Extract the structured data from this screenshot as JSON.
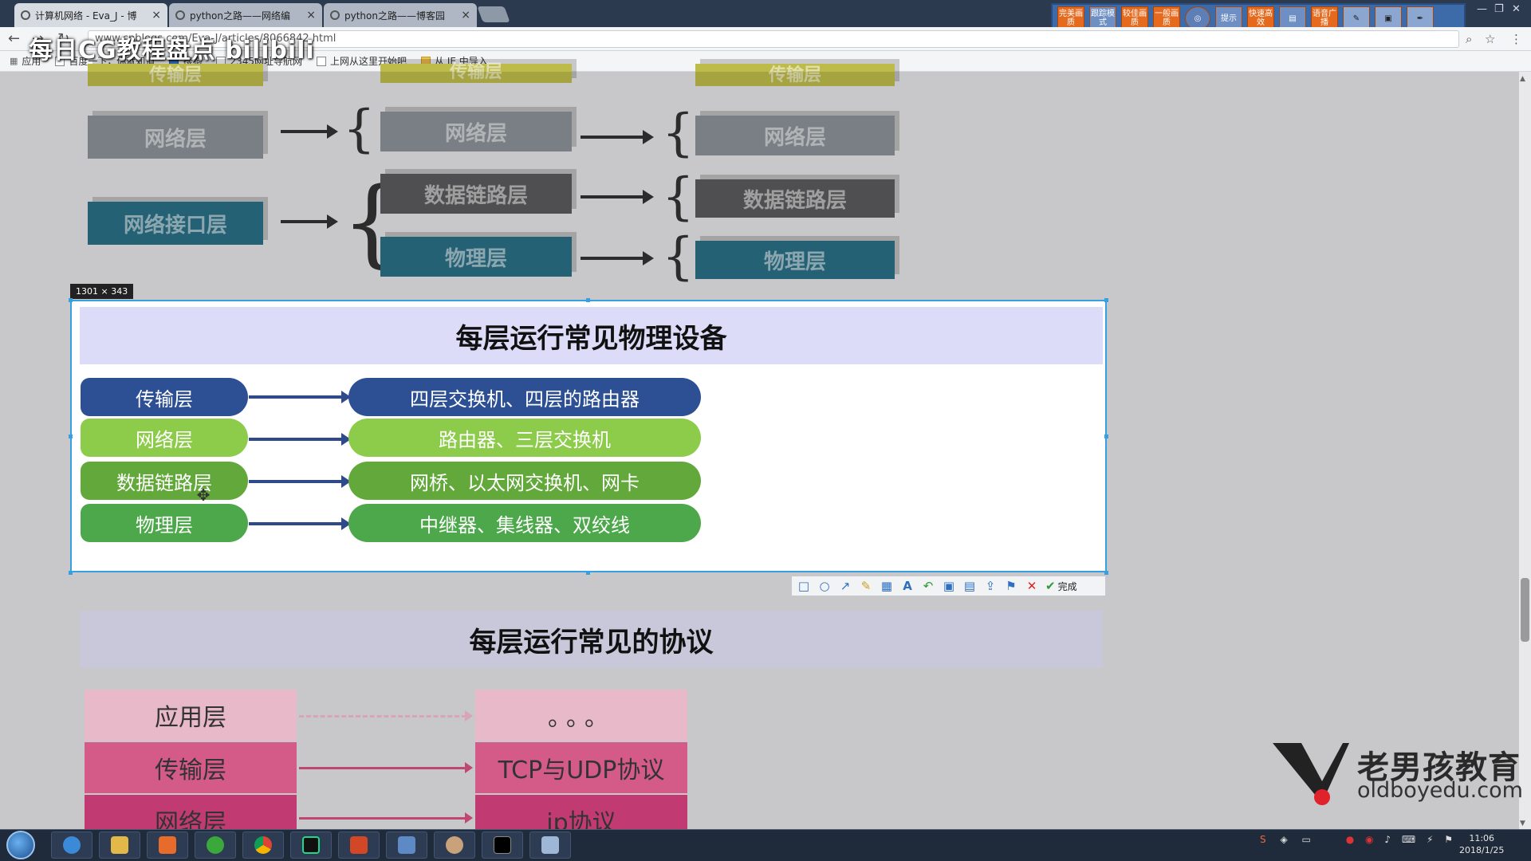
{
  "browser": {
    "tabs": [
      {
        "label": "计算机网络 - Eva_J - 博"
      },
      {
        "label": "python之路——网络编"
      },
      {
        "label": "python之路——博客园"
      }
    ],
    "url": "www.cnblogs.com/Eva-J/articles/8066842.html",
    "bookmarks": [
      "应用",
      "百度一下，你就知道",
      "搜狗",
      "2345网址导航网",
      "上网从这里开始吧",
      "从 IE 中导入"
    ],
    "watermark": "每日CG教程盘点 bilibili"
  },
  "extension_toolbar": [
    "完美画质",
    "跟踪模式",
    "较佳画质",
    "一般画质",
    "提示",
    "快速高效",
    "语音广播"
  ],
  "page": {
    "upper_diagram": {
      "col1": [
        "传输层",
        "网络层",
        "网络接口层"
      ],
      "col2": [
        "传输层",
        "网络层",
        "数据链路层",
        "物理层"
      ],
      "col3": [
        "传输层",
        "网络层",
        "数据链路层",
        "物理层"
      ]
    },
    "selection": {
      "size_label": "1301 × 343",
      "title": "每层运行常见物理设备",
      "rows": [
        {
          "layer": "传输层",
          "devices": "四层交换机、四层的路由器"
        },
        {
          "layer": "网络层",
          "devices": "路由器、三层交换机"
        },
        {
          "layer": "数据链路层",
          "devices": "网桥、以太网交换机、网卡"
        },
        {
          "layer": "物理层",
          "devices": "中继器、集线器、双绞线"
        }
      ]
    },
    "snip_toolbar": {
      "done_label": "完成",
      "tools": [
        "rectangle-tool",
        "ellipse-tool",
        "arrow-tool",
        "pen-tool",
        "mosaic-tool",
        "text-tool",
        "undo-tool",
        "save-tool",
        "copy-tool",
        "share-tool",
        "pin-tool"
      ]
    },
    "protocols": {
      "title": "每层运行常见的协议",
      "rows": [
        {
          "layer": "应用层",
          "protocol": "。。。"
        },
        {
          "layer": "传输层",
          "protocol": "TCP与UDP协议"
        },
        {
          "layer": "网络层",
          "protocol": "ip协议"
        }
      ]
    },
    "logo": {
      "cn": "老男孩教育",
      "en": "oldboyedu.com"
    }
  },
  "taskbar": {
    "clock_time": "11:06",
    "clock_date": "2018/1/25"
  }
}
